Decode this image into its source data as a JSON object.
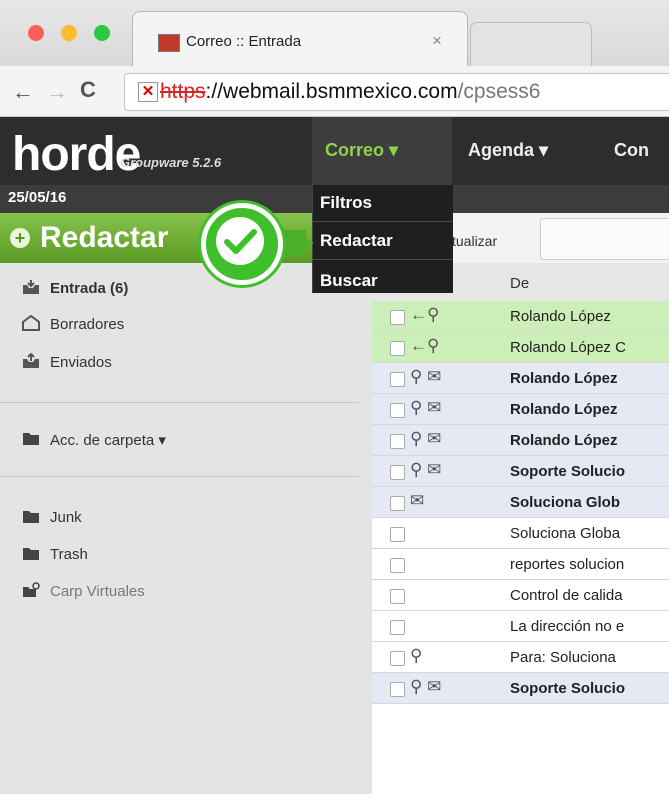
{
  "browser": {
    "tab_title": "Correo :: Entrada",
    "tab_close": "×",
    "url_https": "https",
    "url_host": "://webmail.bsmmexico.com",
    "url_rest": "/cpsess6",
    "back": "←",
    "forward": "→",
    "reload": "C",
    "insecure_mark": "✕"
  },
  "horde": {
    "logo": "horde",
    "logo_sub": "Groupware 5.2.6",
    "menus": [
      {
        "label": "Correo ▾"
      },
      {
        "label": "Agenda ▾"
      },
      {
        "label": "Con"
      }
    ],
    "date": "25/05/16",
    "dropdown": [
      "Filtros",
      "Redactar",
      "Buscar"
    ]
  },
  "sidebar": {
    "compose_label": "Redactar",
    "folders": [
      {
        "label": "Entrada (6)",
        "bold": true
      },
      {
        "label": "Borradores",
        "bold": false
      },
      {
        "label": "Enviados",
        "bold": false
      }
    ],
    "folder_actions": "Acc. de carpeta ▾",
    "extra_folders": [
      {
        "label": "Junk"
      },
      {
        "label": "Trash"
      },
      {
        "label": "Carp Virtuales"
      }
    ]
  },
  "toolbar": {
    "actualizar": "tualizar"
  },
  "list": {
    "header_from": "De",
    "rows": [
      {
        "icons": "←⚲",
        "from": "Rolando López",
        "bold": false,
        "bg": "#ccefb8"
      },
      {
        "icons": "←⚲",
        "from": "Rolando López C",
        "bold": false,
        "bg": "#ccefb8"
      },
      {
        "icons": "⚲ ✉",
        "from": "Rolando López",
        "bold": true,
        "bg": "#e4e9f3"
      },
      {
        "icons": "⚲ ✉",
        "from": "Rolando López",
        "bold": true,
        "bg": "#e4e9f3"
      },
      {
        "icons": "⚲ ✉",
        "from": "Rolando López",
        "bold": true,
        "bg": "#e4e9f3"
      },
      {
        "icons": "⚲ ✉",
        "from": "Soporte Solucio",
        "bold": true,
        "bg": "#e4e9f3"
      },
      {
        "icons": "✉",
        "from": "Soluciona Glob",
        "bold": true,
        "bg": "#e4e9f3"
      },
      {
        "icons": "",
        "from": "Soluciona Globa",
        "bold": false,
        "bg": "#ffffff"
      },
      {
        "icons": "",
        "from": "reportes solucion",
        "bold": false,
        "bg": "#ffffff"
      },
      {
        "icons": "",
        "from": "Control de calida",
        "bold": false,
        "bg": "#ffffff"
      },
      {
        "icons": "",
        "from": "La dirección no e",
        "bold": false,
        "bg": "#ffffff"
      },
      {
        "icons": "⚲",
        "from": "Para: Soluciona",
        "bold": false,
        "bg": "#ffffff"
      },
      {
        "icons": "⚲ ✉",
        "from": "Soporte Solucio",
        "bold": true,
        "bg": "#e4e9f3"
      }
    ]
  },
  "colors": {
    "accent_green": "#5a9a24",
    "menu_active": "#8fd14a",
    "header_bg": "#2d2d2d"
  }
}
